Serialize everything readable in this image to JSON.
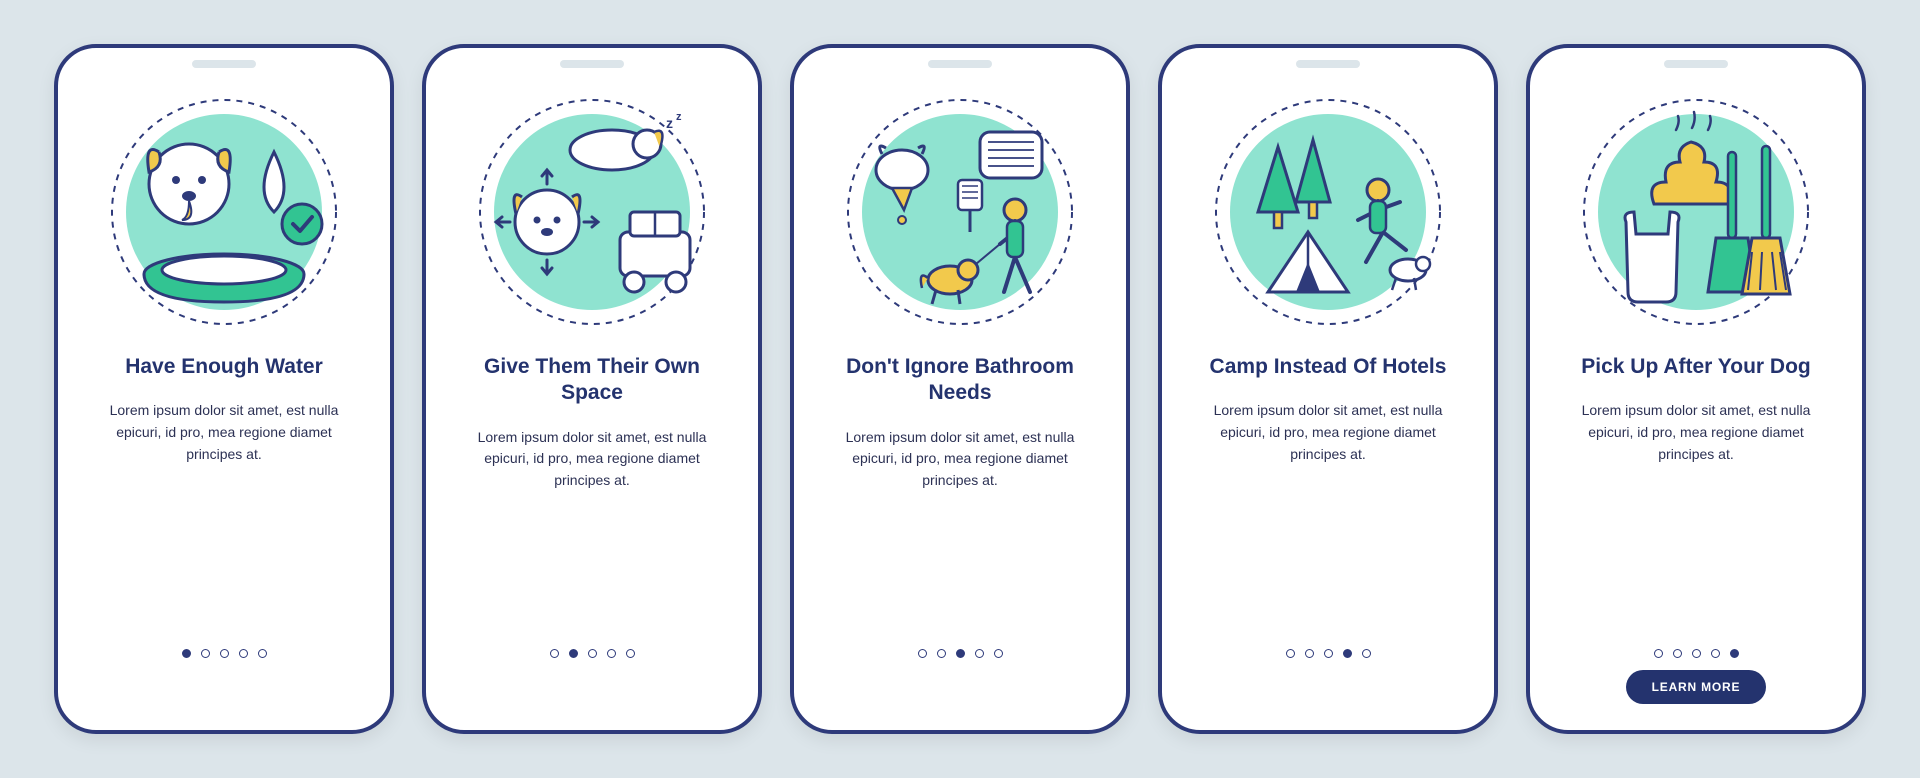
{
  "cta_label": "LEARN MORE",
  "body_text": "Lorem ipsum dolor sit amet, est nulla epicuri, id pro, mea regione diamet principes at.",
  "cards": [
    {
      "title": "Have Enough Water",
      "icon": "water-bowl",
      "active_dot": 0,
      "show_cta": false
    },
    {
      "title": "Give Them Their Own Space",
      "icon": "dog-space",
      "active_dot": 1,
      "show_cta": false
    },
    {
      "title": "Don't Ignore Bathroom Needs",
      "icon": "walk-dog",
      "active_dot": 2,
      "show_cta": false
    },
    {
      "title": "Camp Instead Of Hotels",
      "icon": "camp",
      "active_dot": 3,
      "show_cta": false
    },
    {
      "title": "Pick Up After Your Dog",
      "icon": "cleanup",
      "active_dot": 4,
      "show_cta": true
    }
  ],
  "colors": {
    "navy": "#2e3a7a",
    "mint": "#8fe3d0",
    "green": "#32c492",
    "yellow": "#f2c94c",
    "white": "#ffffff"
  },
  "num_dots": 5
}
